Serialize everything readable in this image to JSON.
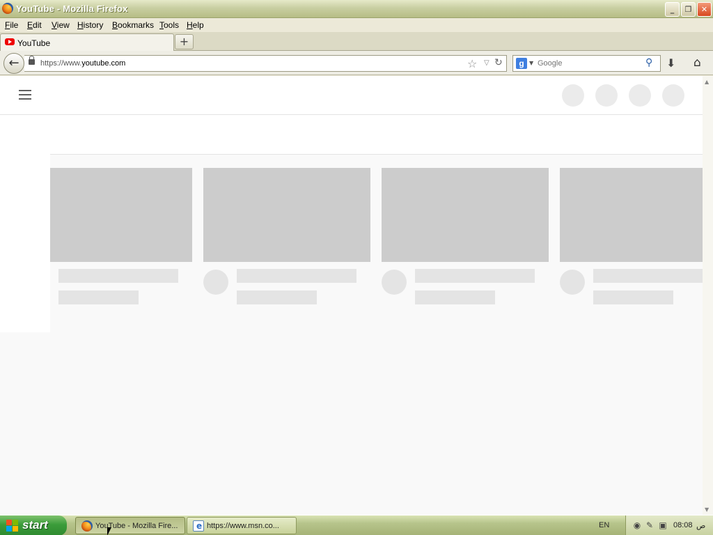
{
  "window": {
    "title": "YouTube - Mozilla Firefox",
    "buttons": {
      "minimize": "_",
      "maximize": "❐",
      "close": "✕"
    }
  },
  "menubar": {
    "items": [
      "File",
      "Edit",
      "View",
      "History",
      "Bookmarks",
      "Tools",
      "Help"
    ]
  },
  "tabs": [
    {
      "label": "YouTube",
      "icon": "youtube-icon"
    }
  ],
  "new_tab_label": "+",
  "navbar": {
    "url_prefix": "https://www.",
    "url_host": "youtube.com",
    "search_engine": "Google",
    "search_placeholder": "Google",
    "icons": [
      "back-arrow-icon",
      "lock-icon",
      "bookmark-star-icon",
      "dropdown-icon",
      "reload-icon",
      "google-icon",
      "search-magnifier-icon",
      "download-icon",
      "home-icon"
    ]
  },
  "taskbar": {
    "start_label": "start",
    "tasks": [
      {
        "label": "YouTube - Mozilla Fire...",
        "icon": "firefox-icon",
        "active": true
      },
      {
        "label": "https://www.msn.co...",
        "icon": "internet-explorer-icon",
        "active": false
      }
    ],
    "language": "EN",
    "clock": "08:08",
    "ampm": "ص"
  },
  "colors": {
    "titlebar": "#b6bd86",
    "taskbar": "#a6b377",
    "start_button": "#3b9c3a",
    "placeholder_thumb": "#cccccc",
    "placeholder_line": "#e4e4e4",
    "page_bg": "#f9f9f9"
  }
}
